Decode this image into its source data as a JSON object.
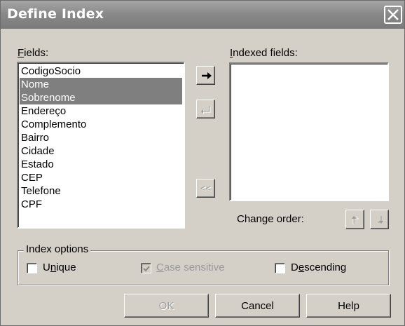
{
  "dialog": {
    "title": "Define Index",
    "close_icon": "close-icon"
  },
  "fields": {
    "label_prefix": "",
    "label_accel": "F",
    "label_rest": "ields:",
    "items": [
      {
        "label": "CodigoSocio",
        "selected": false
      },
      {
        "label": "Nome",
        "selected": true
      },
      {
        "label": "Sobrenome",
        "selected": true
      },
      {
        "label": "Endereço",
        "selected": false
      },
      {
        "label": "Complemento",
        "selected": false
      },
      {
        "label": "Bairro",
        "selected": false
      },
      {
        "label": "Cidade",
        "selected": false
      },
      {
        "label": "Estado",
        "selected": false
      },
      {
        "label": "CEP",
        "selected": false
      },
      {
        "label": "Telefone",
        "selected": false
      },
      {
        "label": "CPF",
        "selected": false
      }
    ]
  },
  "indexed_fields": {
    "label_accel": "I",
    "label_rest": "ndexed fields:",
    "items": []
  },
  "transfer_buttons": {
    "add_icon": "right-arrow-icon",
    "remove_icon": "left-return-arrow-icon",
    "remove_all_label": "<<"
  },
  "change_order": {
    "label": "Change order:",
    "up_icon": "move-up-icon",
    "down_icon": "move-down-icon"
  },
  "index_options": {
    "label": "Index options",
    "unique": {
      "pre": "U",
      "accel": "n",
      "post": "ique",
      "checked": false,
      "enabled": true
    },
    "case_sensitive": {
      "pre": "",
      "accel": "C",
      "post": "ase sensitive",
      "checked": true,
      "enabled": false
    },
    "descending": {
      "pre": "D",
      "accel": "e",
      "post": "scending",
      "checked": false,
      "enabled": true
    }
  },
  "buttons": {
    "ok": "OK",
    "cancel": "Cancel",
    "help": "Help"
  }
}
